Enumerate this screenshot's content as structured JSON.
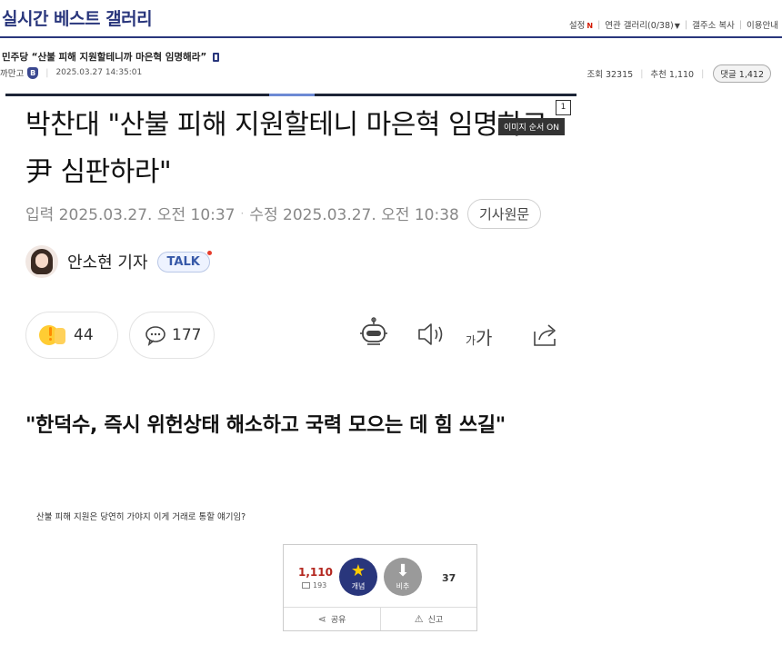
{
  "header": {
    "site_title": "실시간 베스트 갤러리",
    "links": {
      "settings": "설정",
      "settings_badge": "N",
      "related_gallery": "연관 갤러리(0/38)",
      "copy_address": "갤주소 복사",
      "guide": "이용안내"
    }
  },
  "post": {
    "title": "민주당 “산불 피해 지원할테니까 마은혁 임명해라”",
    "author": "까만고",
    "author_badge": "B",
    "datetime": "2025.03.27 14:35:01",
    "views_label": "조회 32315",
    "recommend_label": "추천 1,110",
    "comments_label": "댓글 1,412"
  },
  "article": {
    "headline": "박찬대 \"산불 피해 지원할테니 마은혁 임명하고 尹 심판하라\"",
    "image_order": "이미지 순서 ON",
    "image_number": "1",
    "input_date": "입력 2025.03.27. 오전 10:37",
    "modified_date": "수정 2025.03.27. 오전 10:38",
    "original_button": "기사원문",
    "reporter": "안소현 기자",
    "talk": "TALK",
    "like_count": "44",
    "comment_count": "177",
    "font_small": "가",
    "font_big": "가",
    "subheadline": "\"한덕수, 즉시 위헌상태 해소하고 국력 모으는 데 힘 쓰길\""
  },
  "body_text": "산불 피해 지원은 당연히 가야지 이게 거래로 통할 얘기임?",
  "vote": {
    "up_count": "1,110",
    "fix_count": "193",
    "up_label": "개념",
    "down_label": "비추",
    "down_count": "37",
    "share": "공유",
    "report": "신고"
  }
}
